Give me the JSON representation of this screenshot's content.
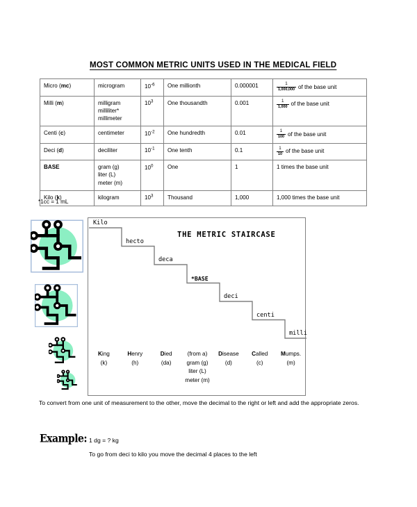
{
  "document": {
    "title": "MOST COMMON METRIC UNITS USED IN THE MEDICAL FIELD",
    "footnote": "*1cc = 1 mL"
  },
  "units_table": {
    "rows": [
      {
        "prefix": "Micro (",
        "prefix_abbr": "mc",
        "prefix_tail": ")",
        "prefix_bold": false,
        "units": [
          "microgram"
        ],
        "power_base": "10",
        "power_exp": "-6",
        "meaning": "One millionth",
        "decimal": "0.000001",
        "frac_num": "1",
        "frac_den": "1,000,000",
        "frac_text": "of the base unit",
        "plain_text": ""
      },
      {
        "prefix": "Milli (",
        "prefix_abbr": "m",
        "prefix_tail": ")",
        "prefix_bold": false,
        "units": [
          "milligram",
          "milliliter*",
          "millimeter"
        ],
        "power_base": "10",
        "power_exp": "3",
        "meaning": "One thousandth",
        "decimal": "0.001",
        "frac_num": "1",
        "frac_den": "1,000",
        "frac_text": "of the base unit",
        "plain_text": ""
      },
      {
        "prefix": "Centi (",
        "prefix_abbr": "c",
        "prefix_tail": ")",
        "prefix_bold": false,
        "units": [
          "centimeter"
        ],
        "power_base": "10",
        "power_exp": "-2",
        "meaning": "One hundredth",
        "decimal": "0.01",
        "frac_num": "1",
        "frac_den": "100",
        "frac_text": "of the base unit",
        "plain_text": ""
      },
      {
        "prefix": "Deci (",
        "prefix_abbr": "d",
        "prefix_tail": ")",
        "prefix_bold": false,
        "units": [
          "deciliter"
        ],
        "power_base": "10",
        "power_exp": "-1",
        "meaning": "One tenth",
        "decimal": "0.1",
        "frac_num": "1",
        "frac_den": "10",
        "frac_text": "of the base unit",
        "plain_text": ""
      },
      {
        "prefix": "BASE",
        "prefix_abbr": "",
        "prefix_tail": "",
        "prefix_bold": true,
        "units": [
          "gram (g)",
          "liter (L)",
          "meter (m)"
        ],
        "power_base": "10",
        "power_exp": "0",
        "meaning": "One",
        "decimal": "1",
        "frac_num": "",
        "frac_den": "",
        "frac_text": "",
        "plain_text": "1 times the base unit"
      },
      {
        "prefix": "Kilo (",
        "prefix_abbr": "k",
        "prefix_tail": ")",
        "prefix_bold": false,
        "units": [
          "kilogram"
        ],
        "power_base": "10",
        "power_exp": "3",
        "meaning": "Thousand",
        "decimal": "1,000",
        "frac_num": "",
        "frac_den": "",
        "frac_text": "",
        "plain_text": "1,000 times the base unit"
      }
    ]
  },
  "staircase": {
    "title": "THE METRIC STAIRCASE",
    "steps": [
      {
        "label": "Kilo",
        "bold": false
      },
      {
        "label": "hecto",
        "bold": false
      },
      {
        "label": "deca",
        "bold": false
      },
      {
        "label": "*BASE",
        "bold": true
      },
      {
        "label": "deci",
        "bold": false
      },
      {
        "label": "centi",
        "bold": false
      },
      {
        "label": "milli",
        "bold": false
      }
    ],
    "mnemonic": [
      {
        "initial": "K",
        "rest": "ing",
        "sub": [
          "(k)"
        ]
      },
      {
        "initial": "H",
        "rest": "enry",
        "sub": [
          "(h)"
        ]
      },
      {
        "initial": "D",
        "rest": "ied",
        "sub": [
          "(da)"
        ]
      },
      {
        "initial": "",
        "rest": "(from a)",
        "sub": [
          "gram (g)",
          "liter (L)",
          "meter (m)"
        ]
      },
      {
        "initial": "D",
        "rest": "isease",
        "sub": [
          "(d)"
        ]
      },
      {
        "initial": "C",
        "rest": "alled",
        "sub": [
          "(c)"
        ]
      },
      {
        "initial": "M",
        "rest": "umps.",
        "sub": [
          "(m)"
        ]
      }
    ]
  },
  "bottom": {
    "convert_note": "To convert from one unit of measurement to the other, move the decimal to the right or left and add the appropriate zeros.",
    "example_label": "Example:",
    "example_equation": "1 dg = ? kg",
    "example_explanation": "To go from deci to kilo you move the decimal 4 places to the left"
  },
  "colors": {
    "icon_green": "#8CEFC3",
    "icon_border": "#A8BEDC",
    "table_border": "#808080",
    "text": "#000000"
  }
}
